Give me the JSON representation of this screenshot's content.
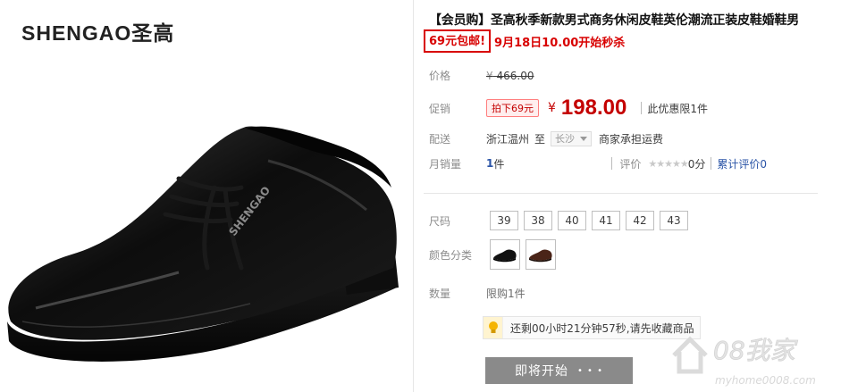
{
  "brand": {
    "name": "SHENGAO圣高"
  },
  "shoe_logo_text": "SHENGAO",
  "product": {
    "title": "【会员购】圣高秋季新款男式商务休闲皮鞋英伦潮流正装皮鞋婚鞋男",
    "promo_box": "69元包邮!",
    "promo_text": "9月18日10.00开始秒杀"
  },
  "price_row": {
    "label": "价格",
    "currency": "¥",
    "value": "466.00"
  },
  "promo_row": {
    "label": "促销",
    "badge": "拍下69元",
    "currency": "¥",
    "value": "198.00",
    "limit": "此优惠限1件"
  },
  "shipping_row": {
    "label": "配送",
    "from": "浙江温州",
    "to_word": "至",
    "dest": "长沙",
    "fee": "商家承担运费"
  },
  "sales_row": {
    "label": "月销量",
    "count": "1",
    "unit": "件",
    "rating_label": "评价",
    "stars": "★★★★★",
    "score": "0分",
    "total_label": "累计评价",
    "total_count": "0"
  },
  "size_row": {
    "label": "尺码",
    "options": [
      "39",
      "38",
      "40",
      "41",
      "42",
      "43"
    ]
  },
  "color_row": {
    "label": "颜色分类",
    "options": [
      "black-shoe",
      "brown-shoe"
    ]
  },
  "qty_row": {
    "label": "数量",
    "text": "限购1件"
  },
  "notice": {
    "icon": "lightbulb-icon",
    "text": "还剩00小时21分钟57秒,请先收藏商品"
  },
  "buy_button": {
    "label": "即将开始",
    "dots": "• • •"
  },
  "watermark": {
    "main": "08我家",
    "sub": "myhome0008.com"
  },
  "colors": {
    "accent_red": "#c40000",
    "promo_red": "#d80000",
    "link_blue": "#2953a6",
    "button_grey": "#8a8a8a"
  }
}
